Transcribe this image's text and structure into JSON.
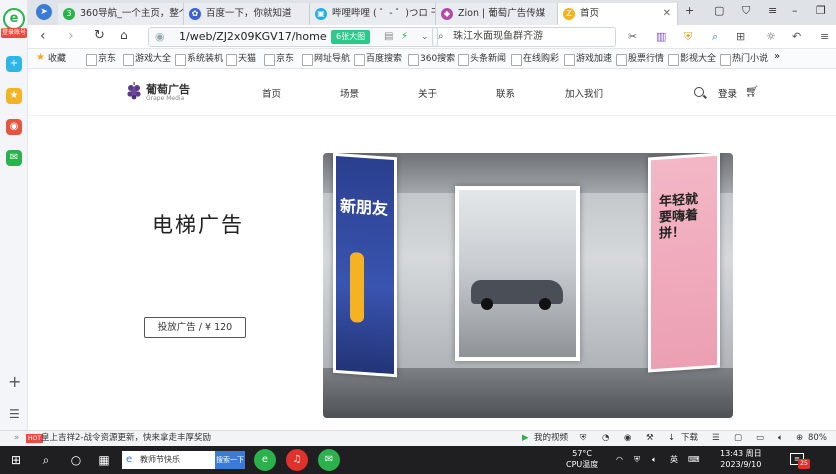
{
  "browser": {
    "tabs": [
      {
        "label": "360导航_一个主页，整个世界"
      },
      {
        "label": "百度一下，你就知道"
      },
      {
        "label": "哔哩哔哩 ( ゜- ゜)つロ 干杯~"
      },
      {
        "label": "Zion | 葡萄广告传媒"
      },
      {
        "label": "首页"
      }
    ],
    "address": {
      "url": "1/web/ZJ2x09KGV17/home",
      "pill": "6张大图",
      "search_text": "珠江水面现鱼群齐游"
    },
    "bookmarks": [
      "收藏",
      "京东",
      "游戏大全",
      "系统装机",
      "天猫",
      "京东",
      "网址导航",
      "百度搜索",
      "360搜索",
      "头条新闻",
      "在线购彩",
      "游戏加速",
      "股票行情",
      "影视大全",
      "热门小说"
    ],
    "left_rail": {
      "login_badge": "登录账号"
    },
    "status": {
      "hot_label": "HOT",
      "news": "皇上吉祥2-战令资源更新，快来拿走丰厚奖励",
      "video": "我的视频",
      "download": "下载",
      "zoom": "80%"
    }
  },
  "site": {
    "logo_name": "葡萄广告",
    "logo_sub": "Grape Media",
    "nav": [
      "首页",
      "场景",
      "关于",
      "联系",
      "加入我们"
    ],
    "login": "登录",
    "hero_title": "电梯广告",
    "cta": "投放广告 / ¥ 120",
    "posters": {
      "left_text": "新朋友",
      "right_text": "年轻就要嗨着拼！"
    }
  },
  "taskbar": {
    "search_text": "教师节快乐",
    "search_button": "搜索一下",
    "temp": "57°C",
    "cpu_label": "CPU温度",
    "ime": "英",
    "time": "13:43 周日",
    "date": "2023/9/10",
    "notif_count": "25"
  }
}
